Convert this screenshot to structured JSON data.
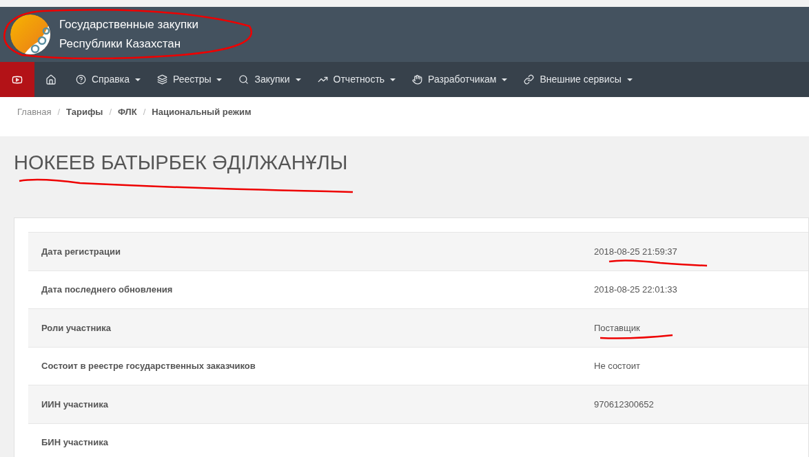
{
  "header": {
    "title_lines": [
      "Государственные закупки",
      "Республики Казахстан"
    ]
  },
  "nav": {
    "items": [
      {
        "label": "Справка"
      },
      {
        "label": "Реестры"
      },
      {
        "label": "Закупки"
      },
      {
        "label": "Отчетность"
      },
      {
        "label": "Разработчикам"
      },
      {
        "label": "Внешние сервисы"
      }
    ]
  },
  "breadcrumb": [
    {
      "label": "Главная",
      "bold": false
    },
    {
      "separator": "/",
      "label": "Тарифы",
      "bold": true
    },
    {
      "separator": "/",
      "label": "ФЛК",
      "bold": true
    },
    {
      "separator": "/",
      "label": "Национальный режим",
      "bold": true
    }
  ],
  "page_title": "НОКЕЕВ БАТЫРБЕК ӘДІЛЖАНҰЛЫ",
  "details": [
    {
      "label": "Дата регистрации",
      "value": "2018-08-25 21:59:37"
    },
    {
      "label": "Дата последнего обновления",
      "value": "2018-08-25 22:01:33"
    },
    {
      "label": "Роли участника",
      "value": "Поставщик"
    },
    {
      "label": "Состоит в реестре государственных заказчиков",
      "value": "Не состоит"
    },
    {
      "label": "ИИН участника",
      "value": "970612300652"
    },
    {
      "label": "БИН участника"
    }
  ]
}
